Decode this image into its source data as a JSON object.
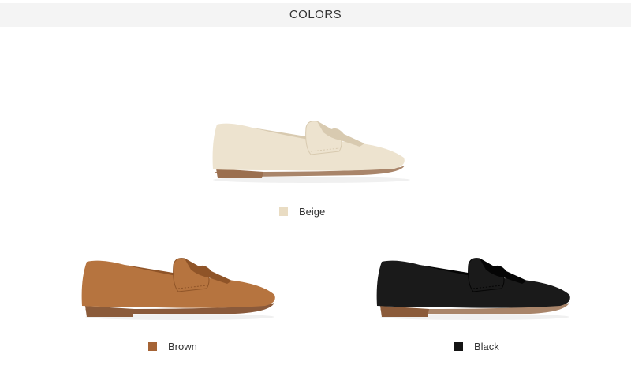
{
  "header": {
    "title": "COLORS"
  },
  "products": [
    {
      "label": "Beige",
      "swatch_color": "#e9dcc3",
      "upper_color": "#ede3cf",
      "upper_shade": "#d8cab0",
      "outsole_color": "#a9856a",
      "heel_color": "#9b6f4f"
    },
    {
      "label": "Brown",
      "swatch_color": "#a56335",
      "upper_color": "#b6743f",
      "upper_shade": "#8f5428",
      "outsole_color": "#8a5a3b",
      "heel_color": "#8b5b3a"
    },
    {
      "label": "Black",
      "swatch_color": "#141414",
      "upper_color": "#1a1a1a",
      "upper_shade": "#050505",
      "outsole_color": "#a9856a",
      "heel_color": "#8b5b3a"
    }
  ]
}
